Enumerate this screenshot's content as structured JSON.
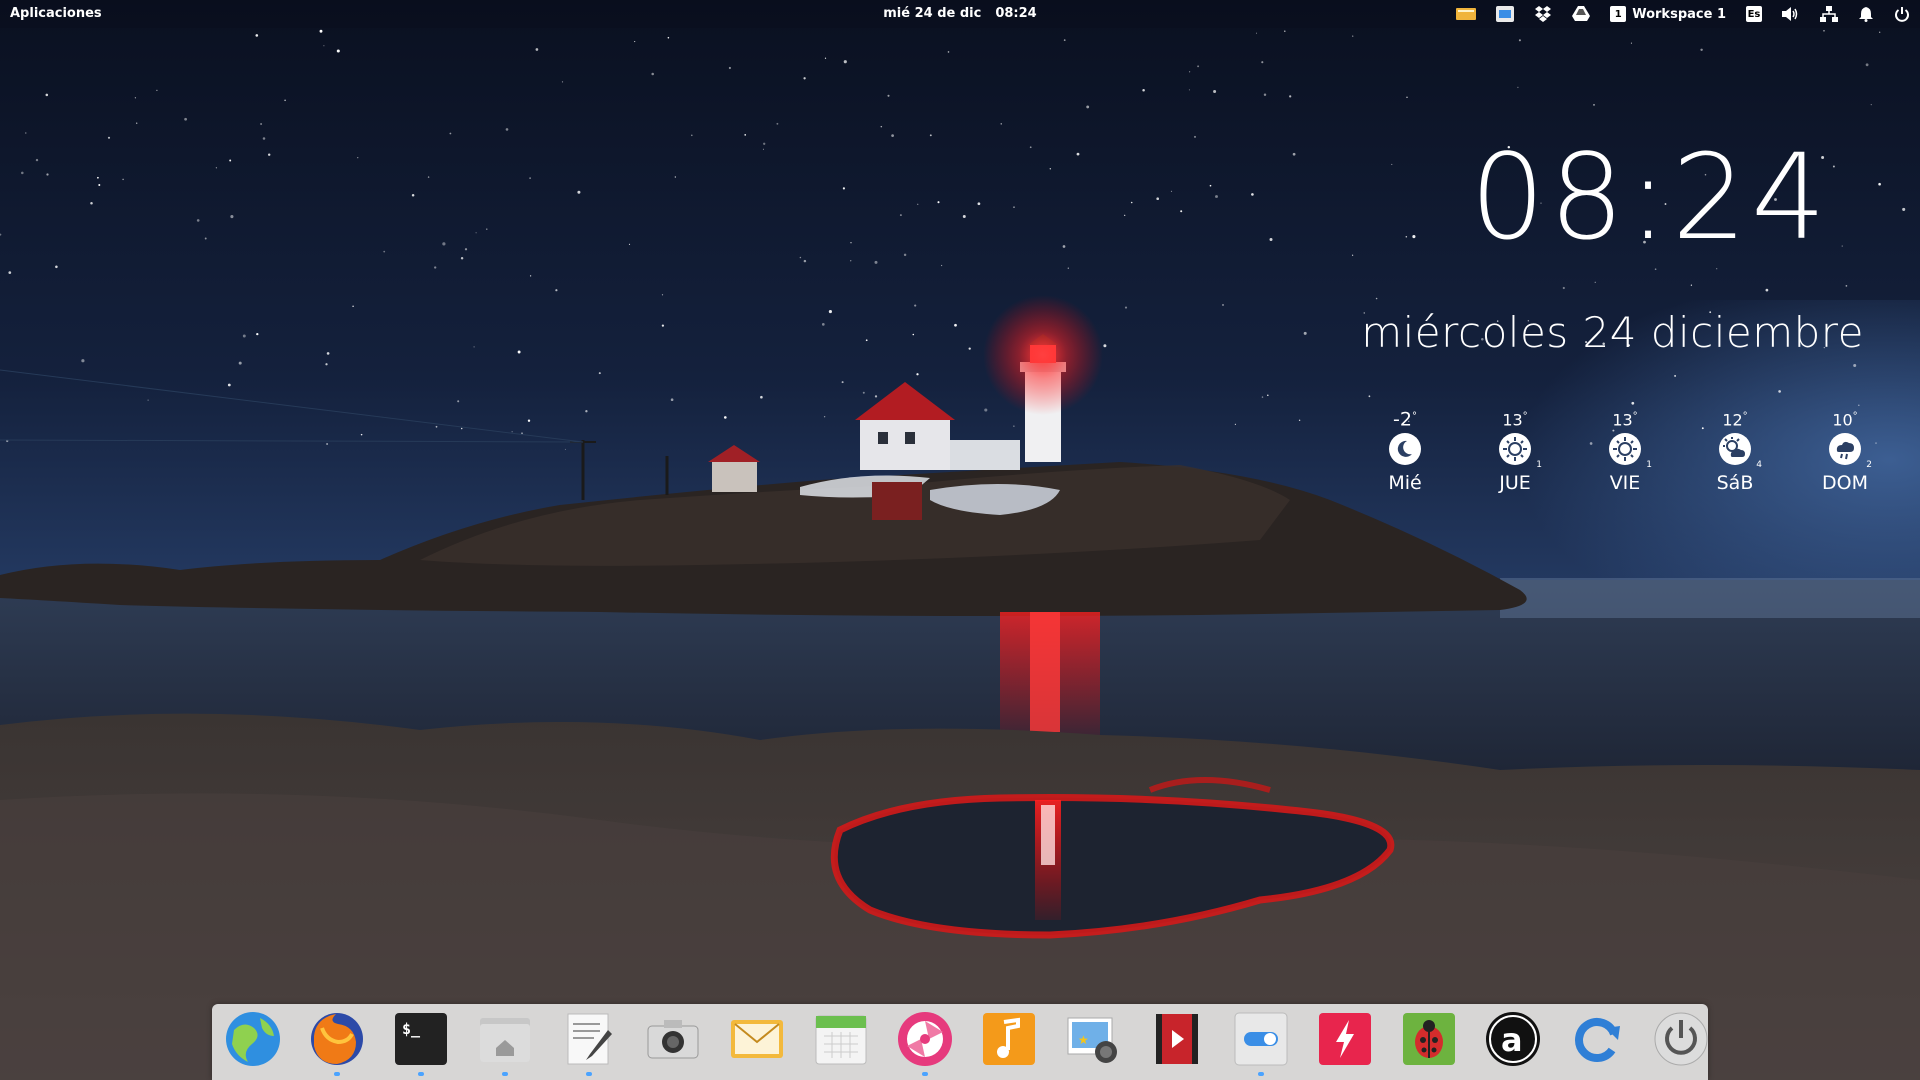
{
  "top_panel": {
    "apps_label": "Aplicaciones",
    "date": "mié 24 de dic",
    "time": "08:24",
    "workspace": {
      "number": "1",
      "label": "Workspace 1"
    },
    "keyboard_layout": "Es",
    "indicators": [
      "messages-icon",
      "display-icon",
      "dropbox-icon",
      "drive-icon",
      "workspace-icon",
      "keyboard-icon",
      "volume-icon",
      "network-icon",
      "notifications-icon",
      "power-icon"
    ]
  },
  "desktop_widget": {
    "clock": "08:24",
    "date": "miércoles 24 diciembre",
    "weather": [
      {
        "day": "Mié",
        "temp": "-2",
        "unit": "°",
        "icon": "moon-icon",
        "sub": ""
      },
      {
        "day": "JUE",
        "temp": "13",
        "unit": "°",
        "icon": "sun-icon",
        "sub": "1"
      },
      {
        "day": "VIE",
        "temp": "13",
        "unit": "°",
        "icon": "sun-icon",
        "sub": "1"
      },
      {
        "day": "SáB",
        "temp": "12",
        "unit": "°",
        "icon": "partly-cloudy-icon",
        "sub": "4"
      },
      {
        "day": "DOM",
        "temp": "10",
        "unit": "°",
        "icon": "rain-cloud-icon",
        "sub": "2"
      }
    ]
  },
  "dock": {
    "items": [
      {
        "name": "browser-globe-icon",
        "running": false
      },
      {
        "name": "firefox-icon",
        "running": true
      },
      {
        "name": "terminal-icon",
        "running": true
      },
      {
        "name": "files-home-icon",
        "running": true
      },
      {
        "name": "text-editor-icon",
        "running": true
      },
      {
        "name": "camera-icon",
        "running": false
      },
      {
        "name": "mail-icon",
        "running": false
      },
      {
        "name": "calendar-icon",
        "running": false
      },
      {
        "name": "music-player-pink-icon",
        "running": true
      },
      {
        "name": "music-note-icon",
        "running": false
      },
      {
        "name": "photos-icon",
        "running": false
      },
      {
        "name": "videos-icon",
        "running": false
      },
      {
        "name": "settings-toggle-icon",
        "running": true
      },
      {
        "name": "flash-icon",
        "running": false
      },
      {
        "name": "bug-report-icon",
        "running": false
      },
      {
        "name": "font-a-icon",
        "running": false
      },
      {
        "name": "update-icon",
        "running": false
      },
      {
        "name": "shutdown-icon",
        "running": false
      }
    ]
  },
  "colors": {
    "sky_top": "#0a1020",
    "sky_horizon": "#2c4a7a",
    "lighthouse_red": "#ff1a1a",
    "dock_bg": "#ebebeb",
    "run_indicator": "#4aa3ff"
  }
}
